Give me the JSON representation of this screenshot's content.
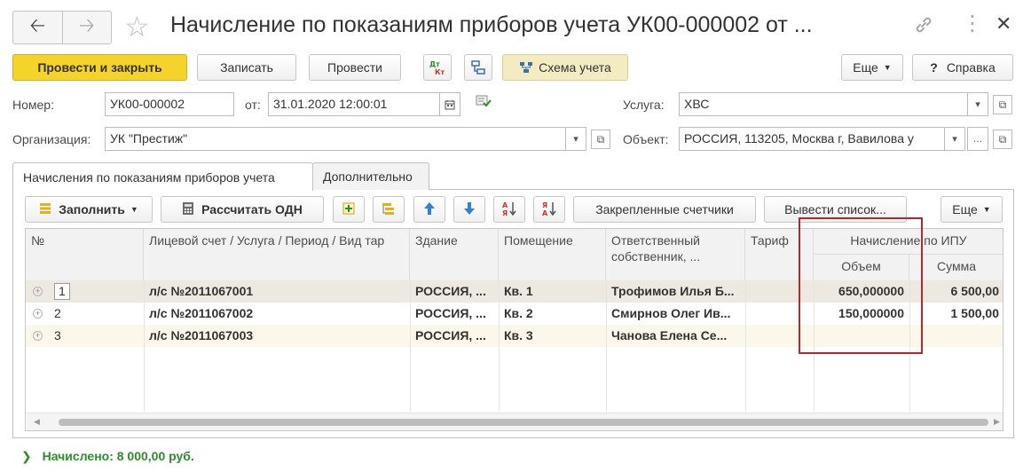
{
  "window": {
    "title": "Начисление по показаниям приборов учета УК00-000002 от ...",
    "nav_back_icon": "arrow-left-icon",
    "nav_forward_icon": "arrow-right-icon",
    "favorite_icon": "star-icon",
    "link_icon": "link-icon",
    "more_icon": "more-vertical-icon",
    "close_icon": "close-icon"
  },
  "toolbar": {
    "post_and_close": "Провести и закрыть",
    "save": "Записать",
    "post": "Провести",
    "dt_kt_icon": "dt-kt-icon",
    "structure_icon": "document-structure-icon",
    "schema": "Схема учета",
    "more": "Еще",
    "help": "Справка",
    "help_icon": "?"
  },
  "form": {
    "number_label": "Номер:",
    "number_value": "УК00-000002",
    "date_label": "от:",
    "date_value": "31.01.2020 12:00:01",
    "service_label": "Услуга:",
    "service_value": "ХВС",
    "organization_label": "Организация:",
    "organization_value": "УК \"Престиж\"",
    "object_label": "Объект:",
    "object_value": "РОССИЯ, 113205, Москва г, Вавилова у"
  },
  "tabs": [
    {
      "label": "Начисления по показаниям приборов учета",
      "active": true
    },
    {
      "label": "Дополнительно",
      "active": false
    }
  ],
  "table_toolbar": {
    "fill": "Заполнить",
    "calc_odn": "Рассчитать ОДН",
    "pinned_meters": "Закрепленные счетчики",
    "export_list": "Вывести список...",
    "more": "Еще"
  },
  "table": {
    "headers": {
      "num": "№",
      "account": "Лицевой счет / Услуга / Период / Вид тар",
      "building": "Здание",
      "premises": "Помещение",
      "owner": "Ответственный собственник, ...",
      "tariff": "Тариф",
      "ipu_group": "Начисление по ИПУ",
      "volume": "Объем",
      "sum": "Сумма"
    },
    "rows": [
      {
        "num": "1",
        "account": "л/с №2011067001",
        "building": "РОССИЯ, ...",
        "premises": "Кв. 1",
        "owner": "Трофимов Илья Б...",
        "tariff": "",
        "volume": "650,000000",
        "sum": "6 500,00"
      },
      {
        "num": "2",
        "account": "л/с №2011067002",
        "building": "РОССИЯ, ...",
        "premises": "Кв. 2",
        "owner": "Смирнов Олег Ив...",
        "tariff": "",
        "volume": "150,000000",
        "sum": "1 500,00"
      },
      {
        "num": "3",
        "account": "л/с №2011067003",
        "building": "РОССИЯ, ...",
        "premises": "Кв. 3",
        "owner": "Чанова Елена Се...",
        "tariff": "",
        "volume": "",
        "sum": ""
      }
    ]
  },
  "footer": {
    "total": "Начислено: 8 000,00 руб."
  },
  "colors": {
    "primary_button": "#f6d32b",
    "schema_button": "#f3ecc2",
    "selected_row": "#ede9e0",
    "alt_row": "#fbf7ea",
    "highlight_border": "#b3282d",
    "total_text": "#2e8b2e"
  }
}
